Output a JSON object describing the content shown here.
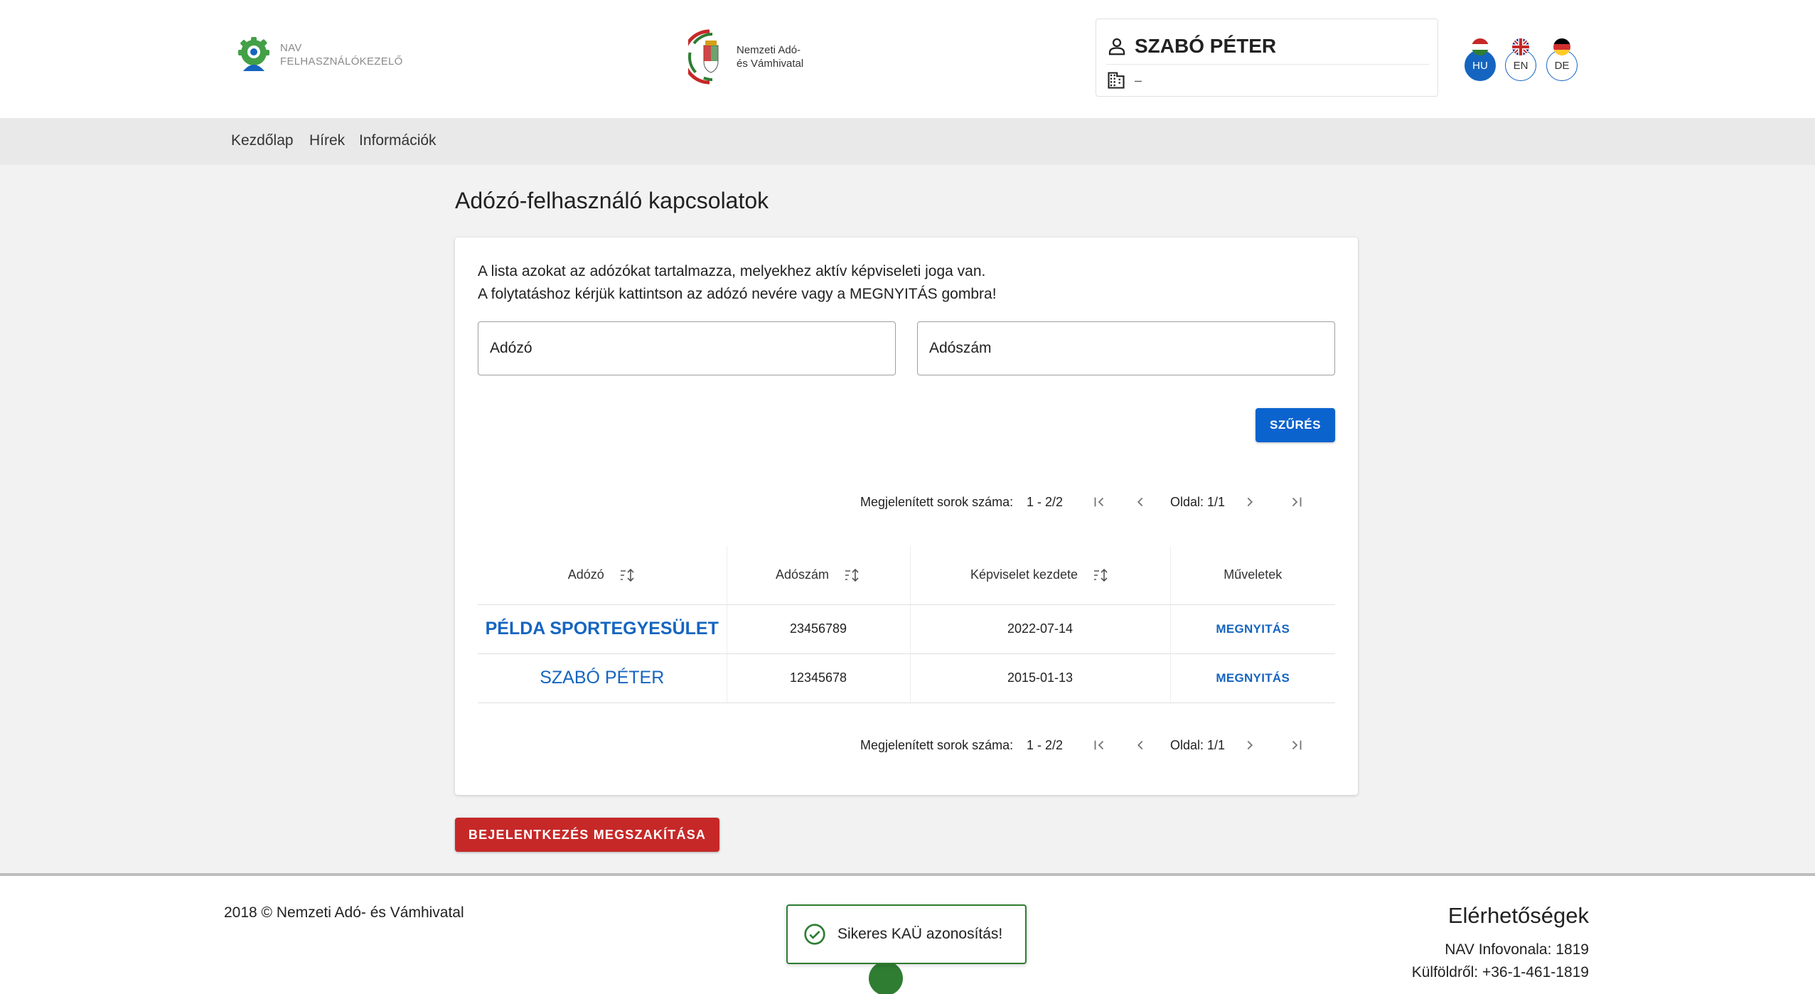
{
  "header": {
    "nav_logo_line1": "NAV",
    "nav_logo_line2": "FELHASZNÁLÓKEZELŐ",
    "gov_logo_line1": "Nemzeti Adó-",
    "gov_logo_line2": "és Vámhivatal",
    "user_name": "SZABÓ PÉTER",
    "organization": "–",
    "languages": [
      {
        "code": "HU",
        "active": true
      },
      {
        "code": "EN",
        "active": false
      },
      {
        "code": "DE",
        "active": false
      }
    ]
  },
  "nav": {
    "items": [
      "Kezdőlap",
      "Hírek",
      "Információk"
    ]
  },
  "main": {
    "title": "Adózó-felhasználó kapcsolatok",
    "intro_line1": "A lista azokat az adózókat tartalmazza, melyekhez aktív képviseleti joga van.",
    "intro_line2": "A folytatáshoz kérjük kattintson az adózó nevére vagy a MEGNYITÁS gombra!",
    "filter_taxpayer_placeholder": "Adózó",
    "filter_taxnumber_placeholder": "Adószám",
    "filter_button": "SZŰRÉS",
    "pager": {
      "rows_label": "Megjelenített sorok száma:",
      "rows_range": "1 - 2/2",
      "page_label": "Oldal: 1/1"
    },
    "table": {
      "headers": [
        "Adózó",
        "Adószám",
        "Képviselet kezdete",
        "Műveletek"
      ],
      "rows": [
        {
          "taxpayer": "PÉLDA SPORTEGYESÜLET",
          "tax_number": "23456789",
          "start": "2022-07-14",
          "action": "MEGNYITÁS"
        },
        {
          "taxpayer": "SZABÓ PÉTER",
          "tax_number": "12345678",
          "start": "2015-01-13",
          "action": "MEGNYITÁS"
        }
      ]
    },
    "cancel_button": "BEJELENTKEZÉS MEGSZAKÍTÁSA"
  },
  "footer": {
    "copyright": "2018 © Nemzeti Adó- és Vámhivatal",
    "contact_title": "Elérhetőségek",
    "infoline": "NAV Infovonala: 1819",
    "abroad": "Külföldről: +36-1-461-1819"
  },
  "toast": {
    "message": "Sikeres KAÜ azonosítás!"
  },
  "colors": {
    "primary": "#0b63ce",
    "danger": "#c62828",
    "success": "#2e7d32",
    "link": "#1565c0"
  }
}
